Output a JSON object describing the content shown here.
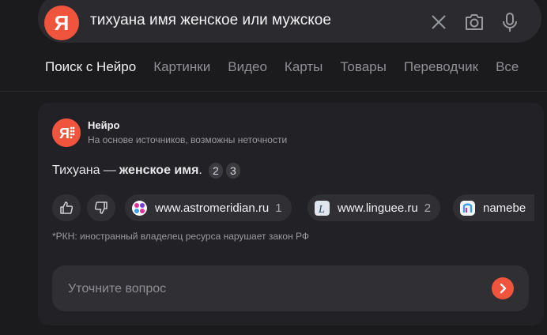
{
  "search": {
    "logo_letter": "Я",
    "query": "тихуана имя женское или мужское",
    "clear_icon": "close-icon",
    "camera_icon": "camera-icon",
    "voice_icon": "microphone-icon"
  },
  "tabs": [
    {
      "label": "Поиск с Нейро",
      "active": true
    },
    {
      "label": "Картинки"
    },
    {
      "label": "Видео"
    },
    {
      "label": "Карты"
    },
    {
      "label": "Товары"
    },
    {
      "label": "Переводчик"
    },
    {
      "label": "Все"
    }
  ],
  "neuro": {
    "logo_letter": "Я",
    "name": "Нейро",
    "subtitle": "На основе источников, возможны неточности",
    "answer_prefix": "Тихуана —",
    "answer_bold": "женское имя",
    "answer_suffix": ".",
    "refs": [
      "2",
      "3"
    ],
    "like_icon": "thumbs-up-icon",
    "dislike_icon": "thumbs-down-icon",
    "sources": [
      {
        "domain": "www.astromeridian.ru",
        "count": "1",
        "icon": "astromeridian-favicon"
      },
      {
        "domain": "www.linguee.ru",
        "count": "2",
        "icon": "linguee-favicon"
      },
      {
        "domain": "namebe",
        "count": "",
        "icon": "namebe-favicon"
      }
    ],
    "disclaimer": "*РКН: иностранный владелец ресурса нарушает закон РФ",
    "followup_placeholder": "Уточните вопрос",
    "send_icon": "chevron-right-icon"
  },
  "colors": {
    "background": "#1b1b1e",
    "card": "#222226",
    "accent": "#f0543c"
  }
}
